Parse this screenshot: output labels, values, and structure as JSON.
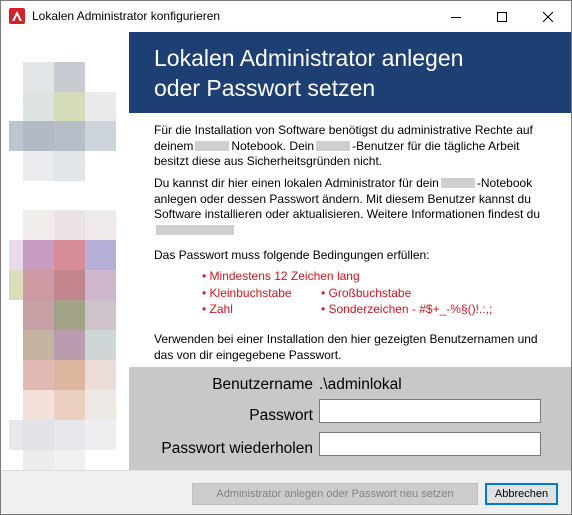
{
  "window": {
    "title": "Lokalen Administrator konfigurieren",
    "controls": {
      "minimize": "window-minimize-icon",
      "maximize": "window-maximize-icon",
      "close": "window-close-icon"
    }
  },
  "banner": {
    "line1": "Lokalen Administrator anlegen",
    "line2": "oder Passwort setzen",
    "color": "#1e3f73"
  },
  "content": {
    "p1a": "Für die Installation von Software benötigst du administrative Rechte auf deinem",
    "p1b": "Notebook. Dein",
    "p1c": "-Benutzer für die tägliche Arbeit besitzt diese aus Sicherheitsgründen nicht.",
    "p2a": "Du kannst dir hier einen lokalen Administrator für dein",
    "p2b": "-Notebook anlegen oder dessen Passwort ändern. Mit diesem Benutzer kannst du Software installieren oder aktualisieren. Weitere Informationen findest du",
    "p3": "Das Passwort muss folgende Bedingungen erfüllen:",
    "requirements": [
      "• Mindestens 12 Zeichen lang",
      "• Kleinbuchstabe",
      "• Großbuchstabe",
      "• Zahl",
      "• Sonderzeichen - #$+_-%§()!.:,;"
    ],
    "p4": "Verwenden bei einer Installation den hier gezeigten Benutzernamen und das von dir eingegebene Passwort.",
    "requirement_color": "#d4141e"
  },
  "form": {
    "username_label": "Benutzername",
    "username_value": ".\\adminlokal",
    "password_label": "Passwort",
    "password_value": "",
    "repeat_label": "Passwort wiederholen",
    "repeat_value": ""
  },
  "buttons": {
    "create": "Administrator anlegen oder Passwort neu setzen",
    "cancel": "Abbrechen"
  }
}
